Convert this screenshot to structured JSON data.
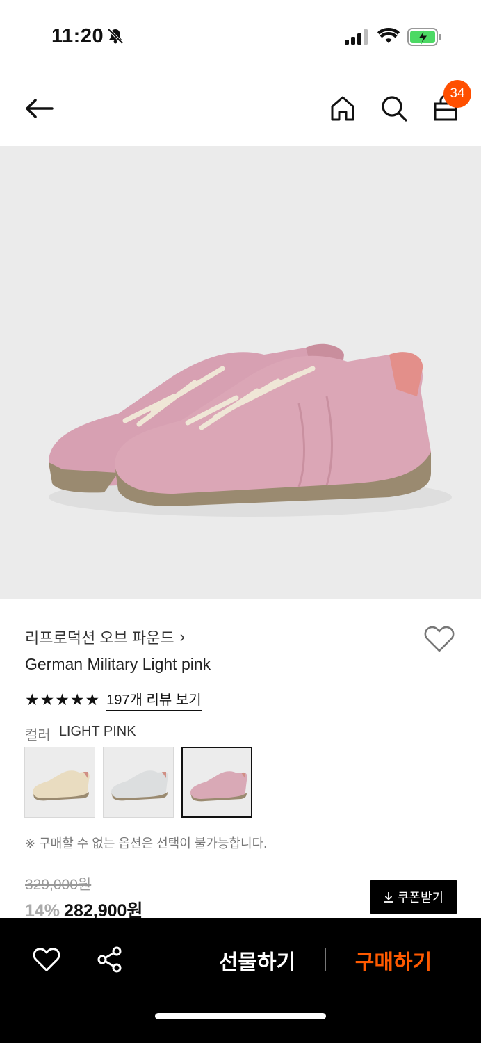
{
  "status_bar": {
    "time": "11:20",
    "icons": [
      "bell-off-icon",
      "signal-icon",
      "wifi-icon",
      "battery-charging-icon"
    ]
  },
  "nav": {
    "icons": [
      "back-arrow-icon",
      "home-icon",
      "search-icon",
      "cart-icon"
    ],
    "cart_count": "34"
  },
  "product": {
    "brand": "리프로덕션 오브 파운드",
    "brand_chevron": "›",
    "name": "German Military Light pink",
    "rating_stars": 5,
    "review_link": "197개 리뷰 보기",
    "color_label": "컬러",
    "color_value": "LIGHT PINK",
    "swatches": [
      {
        "name": "beige",
        "color": "#e9dcc0"
      },
      {
        "name": "grey",
        "color": "#d9dbdc"
      },
      {
        "name": "light-pink",
        "color": "#d9a9b6",
        "selected": true
      }
    ],
    "notice": "※ 구매할 수 없는 옵션은 선택이 불가능합니다.",
    "original_price": "329,000원",
    "discount": "14%",
    "price": "282,900원",
    "coupon_label": "쿠폰받기"
  },
  "bottom_bar": {
    "gift_label": "선물하기",
    "buy_label": "구매하기",
    "icons": [
      "heart-icon",
      "share-icon"
    ]
  },
  "colors": {
    "accent": "#ff5a00",
    "badge": "#ff4f00",
    "shoe_pink": "#dba6b6",
    "sole": "#9a8a70"
  }
}
